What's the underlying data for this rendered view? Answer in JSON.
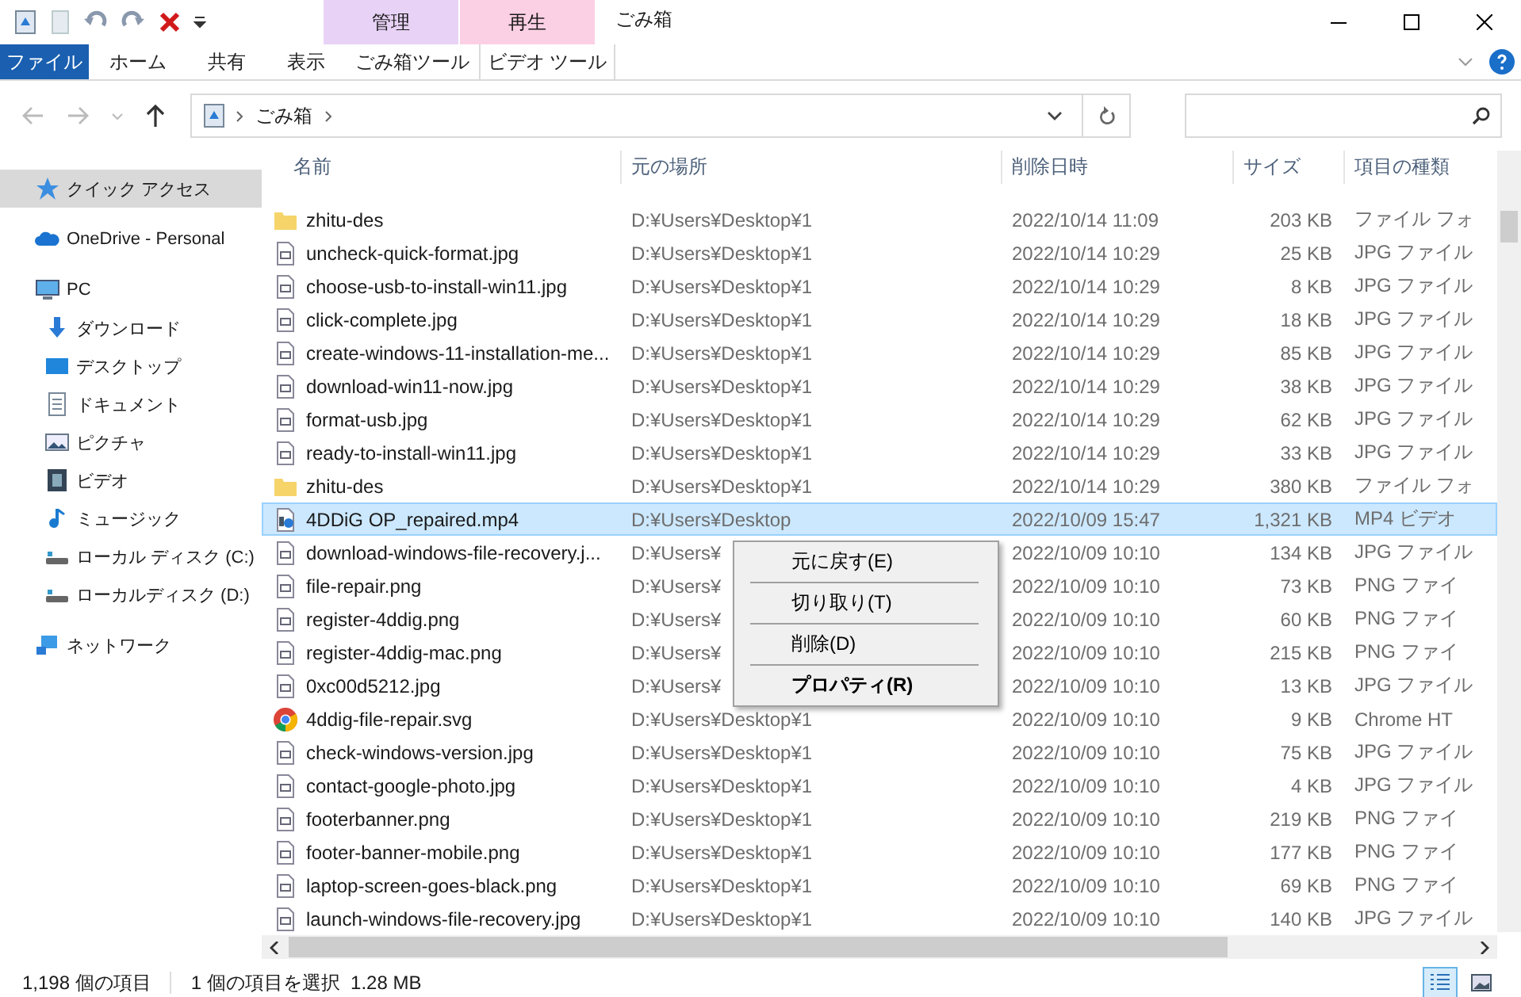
{
  "window": {
    "title": "ごみ箱"
  },
  "ribbon": {
    "context_groups": [
      {
        "label": "管理",
        "color": "#e8d2f6"
      },
      {
        "label": "再生",
        "color": "#fcd0e4"
      }
    ],
    "tabs": [
      {
        "label": "ファイル",
        "kind": "file",
        "selected": false
      },
      {
        "label": "ホーム",
        "kind": "plain",
        "selected": false
      },
      {
        "label": "共有",
        "kind": "plain",
        "selected": false
      },
      {
        "label": "表示",
        "kind": "plain",
        "selected": false
      },
      {
        "label": "ごみ箱ツール",
        "kind": "context",
        "selected": false
      },
      {
        "label": "ビデオ ツール",
        "kind": "context",
        "selected": false
      }
    ]
  },
  "address_bar": {
    "path": [
      "ごみ箱"
    ]
  },
  "nav_pane": {
    "items": [
      {
        "label": "クイック アクセス",
        "kind": "star",
        "selected": true
      },
      {
        "label": "OneDrive - Personal",
        "kind": "cloud",
        "selected": false
      },
      {
        "label": "PC",
        "kind": "pc",
        "selected": false,
        "children": [
          {
            "label": "ダウンロード",
            "kind": "download",
            "selected": false
          },
          {
            "label": "デスクトップ",
            "kind": "desktop",
            "selected": false
          },
          {
            "label": "ドキュメント",
            "kind": "document",
            "selected": false
          },
          {
            "label": "ピクチャ",
            "kind": "picture",
            "selected": false
          },
          {
            "label": "ビデオ",
            "kind": "video",
            "selected": false
          },
          {
            "label": "ミュージック",
            "kind": "music",
            "selected": false
          },
          {
            "label": "ローカル ディスク (C:)",
            "kind": "drive",
            "selected": false
          },
          {
            "label": "ローカルディスク (D:)",
            "kind": "drive",
            "selected": false
          }
        ]
      },
      {
        "label": "ネットワーク",
        "kind": "network",
        "selected": false
      }
    ]
  },
  "table": {
    "columns": [
      "名前",
      "元の場所",
      "削除日時",
      "サイズ",
      "項目の種類"
    ],
    "rows": [
      {
        "name": "zhitu-des",
        "kind": "folder",
        "location": "D:¥Users¥Desktop¥1",
        "date": "2022/10/14 11:09",
        "size": "203 KB",
        "type": "ファイル フォ",
        "selected": false
      },
      {
        "name": "uncheck-quick-format.jpg",
        "kind": "image",
        "location": "D:¥Users¥Desktop¥1",
        "date": "2022/10/14 10:29",
        "size": "25 KB",
        "type": "JPG ファイル",
        "selected": false
      },
      {
        "name": "choose-usb-to-install-win11.jpg",
        "kind": "image",
        "location": "D:¥Users¥Desktop¥1",
        "date": "2022/10/14 10:29",
        "size": "8 KB",
        "type": "JPG ファイル",
        "selected": false
      },
      {
        "name": "click-complete.jpg",
        "kind": "image",
        "location": "D:¥Users¥Desktop¥1",
        "date": "2022/10/14 10:29",
        "size": "18 KB",
        "type": "JPG ファイル",
        "selected": false
      },
      {
        "name": "create-windows-11-installation-me...",
        "kind": "image",
        "location": "D:¥Users¥Desktop¥1",
        "date": "2022/10/14 10:29",
        "size": "85 KB",
        "type": "JPG ファイル",
        "selected": false
      },
      {
        "name": "download-win11-now.jpg",
        "kind": "image",
        "location": "D:¥Users¥Desktop¥1",
        "date": "2022/10/14 10:29",
        "size": "38 KB",
        "type": "JPG ファイル",
        "selected": false
      },
      {
        "name": "format-usb.jpg",
        "kind": "image",
        "location": "D:¥Users¥Desktop¥1",
        "date": "2022/10/14 10:29",
        "size": "62 KB",
        "type": "JPG ファイル",
        "selected": false
      },
      {
        "name": "ready-to-install-win11.jpg",
        "kind": "image",
        "location": "D:¥Users¥Desktop¥1",
        "date": "2022/10/14 10:29",
        "size": "33 KB",
        "type": "JPG ファイル",
        "selected": false
      },
      {
        "name": "zhitu-des",
        "kind": "folder",
        "location": "D:¥Users¥Desktop¥1",
        "date": "2022/10/14 10:29",
        "size": "380 KB",
        "type": "ファイル フォ",
        "selected": false
      },
      {
        "name": "4DDiG OP_repaired.mp4",
        "kind": "video",
        "location": "D:¥Users¥Desktop",
        "date": "2022/10/09 15:47",
        "size": "1,321 KB",
        "type": "MP4 ビデオ",
        "selected": true
      },
      {
        "name": "download-windows-file-recovery.j...",
        "kind": "image",
        "location": "D:¥Users¥",
        "date": "2022/10/09 10:10",
        "size": "134 KB",
        "type": "JPG ファイル",
        "selected": false
      },
      {
        "name": "file-repair.png",
        "kind": "image",
        "location": "D:¥Users¥",
        "date": "2022/10/09 10:10",
        "size": "73 KB",
        "type": "PNG ファイ",
        "selected": false
      },
      {
        "name": "register-4ddig.png",
        "kind": "image",
        "location": "D:¥Users¥",
        "date": "2022/10/09 10:10",
        "size": "60 KB",
        "type": "PNG ファイ",
        "selected": false
      },
      {
        "name": "register-4ddig-mac.png",
        "kind": "image",
        "location": "D:¥Users¥",
        "date": "2022/10/09 10:10",
        "size": "215 KB",
        "type": "PNG ファイ",
        "selected": false
      },
      {
        "name": "0xc00d5212.jpg",
        "kind": "image",
        "location": "D:¥Users¥",
        "date": "2022/10/09 10:10",
        "size": "13 KB",
        "type": "JPG ファイル",
        "selected": false
      },
      {
        "name": "4ddig-file-repair.svg",
        "kind": "chrome",
        "location": "D:¥Users¥Desktop¥1",
        "date": "2022/10/09 10:10",
        "size": "9 KB",
        "type": "Chrome HT",
        "selected": false
      },
      {
        "name": "check-windows-version.jpg",
        "kind": "image",
        "location": "D:¥Users¥Desktop¥1",
        "date": "2022/10/09 10:10",
        "size": "75 KB",
        "type": "JPG ファイル",
        "selected": false
      },
      {
        "name": "contact-google-photo.jpg",
        "kind": "image",
        "location": "D:¥Users¥Desktop¥1",
        "date": "2022/10/09 10:10",
        "size": "4 KB",
        "type": "JPG ファイル",
        "selected": false
      },
      {
        "name": "footerbanner.png",
        "kind": "image",
        "location": "D:¥Users¥Desktop¥1",
        "date": "2022/10/09 10:10",
        "size": "219 KB",
        "type": "PNG ファイ",
        "selected": false
      },
      {
        "name": "footer-banner-mobile.png",
        "kind": "image",
        "location": "D:¥Users¥Desktop¥1",
        "date": "2022/10/09 10:10",
        "size": "177 KB",
        "type": "PNG ファイ",
        "selected": false
      },
      {
        "name": "laptop-screen-goes-black.png",
        "kind": "image",
        "location": "D:¥Users¥Desktop¥1",
        "date": "2022/10/09 10:10",
        "size": "69 KB",
        "type": "PNG ファイ",
        "selected": false
      },
      {
        "name": "launch-windows-file-recovery.jpg",
        "kind": "image",
        "location": "D:¥Users¥Desktop¥1",
        "date": "2022/10/09 10:10",
        "size": "140 KB",
        "type": "JPG ファイル",
        "selected": false
      }
    ]
  },
  "context_menu": {
    "items": [
      {
        "label": "元に戻す(E)",
        "default": false
      },
      {
        "label": "切り取り(T)",
        "default": false
      },
      {
        "label": "削除(D)",
        "default": false
      },
      {
        "label": "プロパティ(R)",
        "default": true
      }
    ]
  },
  "status_bar": {
    "count": "1,198 個の項目",
    "selection": "1 個の項目を選択  1.28 MB"
  }
}
